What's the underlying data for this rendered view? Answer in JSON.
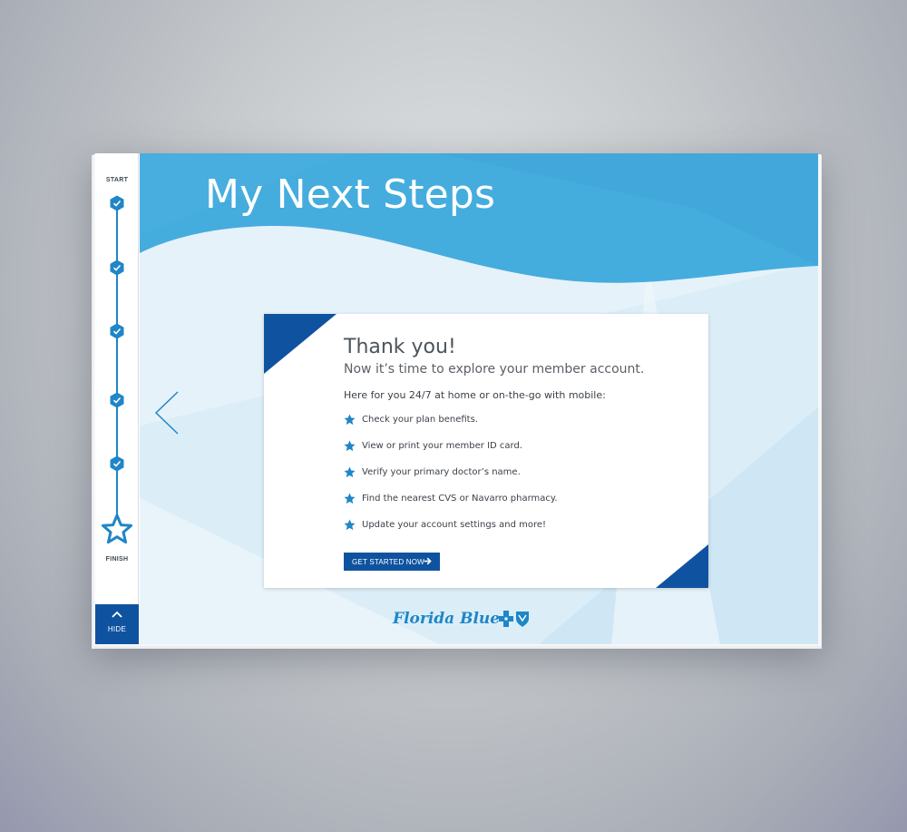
{
  "colors": {
    "brand_blue": "#0f53a0",
    "accent_blue": "#1f86c7",
    "header_blue": "#40a9dc",
    "light_bg": "#ddeef7"
  },
  "sidebar": {
    "start_label": "START",
    "finish_label": "FINISH",
    "completed_steps": 5,
    "step_icon": "check-hexagon-icon",
    "finish_icon": "star-outline-icon",
    "hide_label": "HIDE",
    "hide_icon": "chevron-up-icon"
  },
  "header": {
    "title": "My Next Steps"
  },
  "nav": {
    "prev_icon": "chevron-left-icon"
  },
  "card": {
    "heading": "Thank you!",
    "subheading": "Now it’s time to explore your member account.",
    "intro": "Here for you 24/7 at home or on-the-go with mobile:",
    "bullet_icon": "star-icon",
    "items": [
      "Check your plan benefits.",
      "View or print your member ID card.",
      "Verify your primary doctor’s name.",
      "Find the nearest CVS or Navarro pharmacy.",
      "Update your account settings and more!"
    ],
    "cta_label": "GET STARTED NOW",
    "cta_icon": "arrow-right-icon"
  },
  "footer": {
    "brand": "Florida Blue",
    "logo_icon": "cross-shield-logo-icon"
  }
}
